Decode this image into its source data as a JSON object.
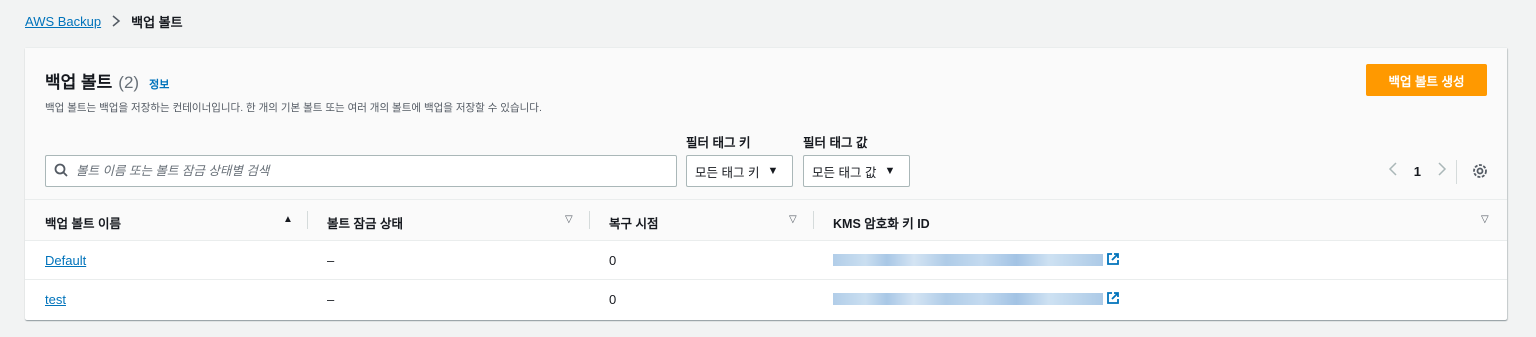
{
  "breadcrumb": {
    "root": "AWS Backup",
    "separator": ">",
    "current": "백업 볼트"
  },
  "panel": {
    "title": "백업 볼트",
    "count": "(2)",
    "info": "정보",
    "description": "백업 볼트는 백업을 저장하는 컨테이너입니다. 한 개의 기본 볼트 또는 여러 개의 볼트에 백업을 저장할 수 있습니다.",
    "create_button": "백업 볼트 생성"
  },
  "filters": {
    "search_placeholder": "볼트 이름 또는 볼트 잠금 상태별 검색",
    "tag_key_label": "필터 태그 키",
    "tag_key_value": "모든 태그 키",
    "tag_value_label": "필터 태그 값",
    "tag_value_value": "모든 태그 값"
  },
  "pagination": {
    "current_page": "1"
  },
  "table": {
    "columns": [
      "백업 볼트 이름",
      "볼트 잠금 상태",
      "복구 시점",
      "KMS 암호화 키 ID"
    ],
    "rows": [
      {
        "name": "Default",
        "lock_status": "–",
        "recovery_points": "0"
      },
      {
        "name": "test",
        "lock_status": "–",
        "recovery_points": "0"
      }
    ]
  },
  "colors": {
    "link": "#0073bb",
    "primary_button": "#ff9900",
    "background": "#f2f3f3"
  },
  "icons": [
    "search-icon",
    "caret-down-icon",
    "chevron-left-icon",
    "chevron-right-icon",
    "settings-icon",
    "sort-ascending-icon",
    "sort-icon",
    "external-link-icon"
  ]
}
